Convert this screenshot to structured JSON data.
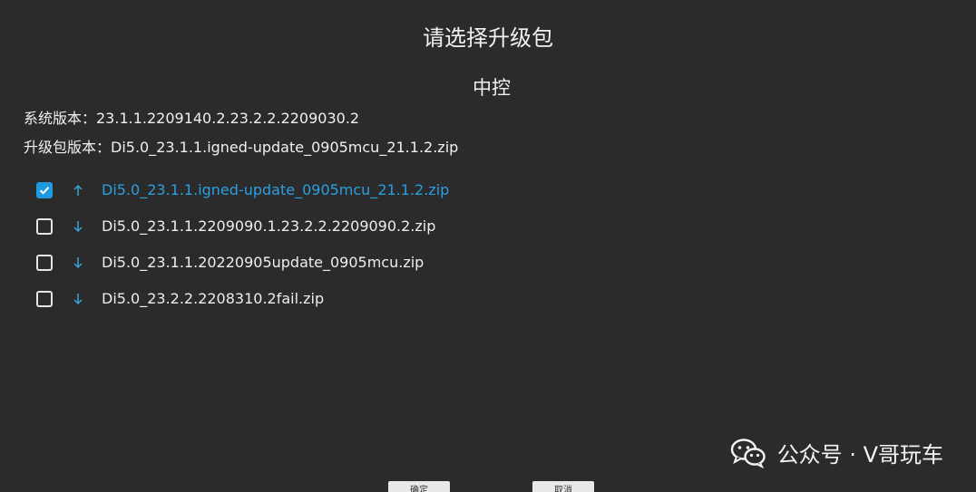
{
  "dialog": {
    "title": "请选择升级包",
    "subtitle": "中控",
    "system_version": "系统版本：23.1.1.2209140.2.23.2.2.2209030.2",
    "package_version": "升级包版本：Di5.0_23.1.1.igned-update_0905mcu_21.1.2.zip"
  },
  "packages": [
    {
      "name": "Di5.0_23.1.1.igned-update_0905mcu_21.1.2.zip",
      "checked": true,
      "direction": "up"
    },
    {
      "name": "Di5.0_23.1.1.2209090.1.23.2.2.2209090.2.zip",
      "checked": false,
      "direction": "down"
    },
    {
      "name": "Di5.0_23.1.1.20220905update_0905mcu.zip",
      "checked": false,
      "direction": "down"
    },
    {
      "name": "Di5.0_23.2.2.2208310.2fail.zip",
      "checked": false,
      "direction": "down"
    }
  ],
  "buttons": {
    "confirm_label": "确定",
    "cancel_label": "取消"
  },
  "watermark": {
    "text": "公众号 · V哥玩车",
    "icon": "wechat-icon"
  },
  "colors": {
    "accent": "#1f9ae0",
    "background": "#2b2b2b",
    "arrow": "#3aa3d8"
  }
}
